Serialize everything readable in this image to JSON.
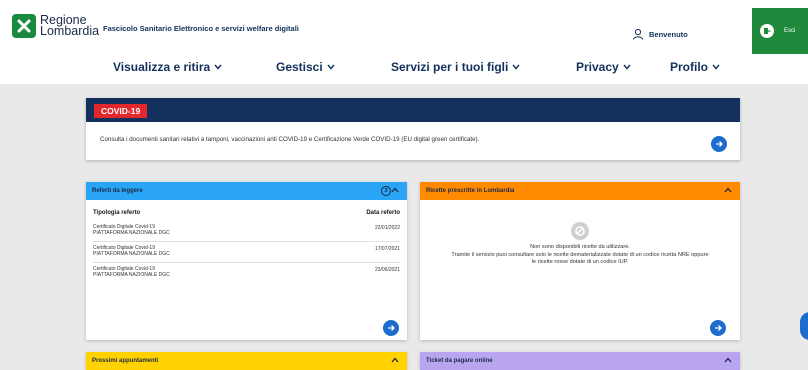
{
  "header": {
    "logo_line1": "Regione",
    "logo_line2": "Lombardia",
    "tagline": "Fascicolo Sanitario Elettronico e servizi welfare digitali",
    "welcome": "Benvenuto",
    "logout_label": "Esci"
  },
  "nav": [
    {
      "label": "Visualizza e ritira"
    },
    {
      "label": "Gestisci"
    },
    {
      "label": "Servizi per i tuoi figli"
    },
    {
      "label": "Privacy"
    },
    {
      "label": "Profilo"
    }
  ],
  "covid": {
    "title": "COVID-19",
    "text": "Consulta i documenti sanitari relativi a tamponi, vaccinazioni anti COVID-19 e Certificazione Verde COVID-19 (EU digital green certificate)."
  },
  "referti": {
    "title": "Referti da leggere",
    "count": "3",
    "col_type": "Tipologia referto",
    "col_date": "Data referto",
    "rows": [
      {
        "name": "Certificato Digitale Covid-19",
        "source": "PIATTAFORMA NAZIONALE DGC",
        "date": "22/01/2022"
      },
      {
        "name": "Certificato Digitale Covid-19",
        "source": "PIATTAFORMA NAZIONALE DGC",
        "date": "17/07/2021"
      },
      {
        "name": "Certificato Digitale Covid-19",
        "source": "PIATTAFORMA NAZIONALE DGC",
        "date": "23/06/2021"
      }
    ]
  },
  "ricette": {
    "title": "Ricette prescritte in Lombardia",
    "empty_line1": "Non sono disponibili ricette da utilizzare.",
    "empty_line2": "Tramite il servizio puoi consultare solo le ricette dematerializzate dotate di un codice ricetta NRE oppure",
    "empty_line3": "le ricette rosse dotate di un codice IUP."
  },
  "appuntamenti": {
    "title": "Prossimi appuntamenti"
  },
  "ticket": {
    "title": "Ticket da pagare online"
  },
  "colors": {
    "navy": "#13315c",
    "green": "#1f8a3b",
    "covid_red": "#e2272d",
    "referti_blue": "#2aa5f5",
    "ricette_orange": "#ff8a00",
    "appuntamenti_yellow": "#ffd200",
    "ticket_lavender": "#b9a5ef",
    "action_blue": "#1b6ccc"
  }
}
